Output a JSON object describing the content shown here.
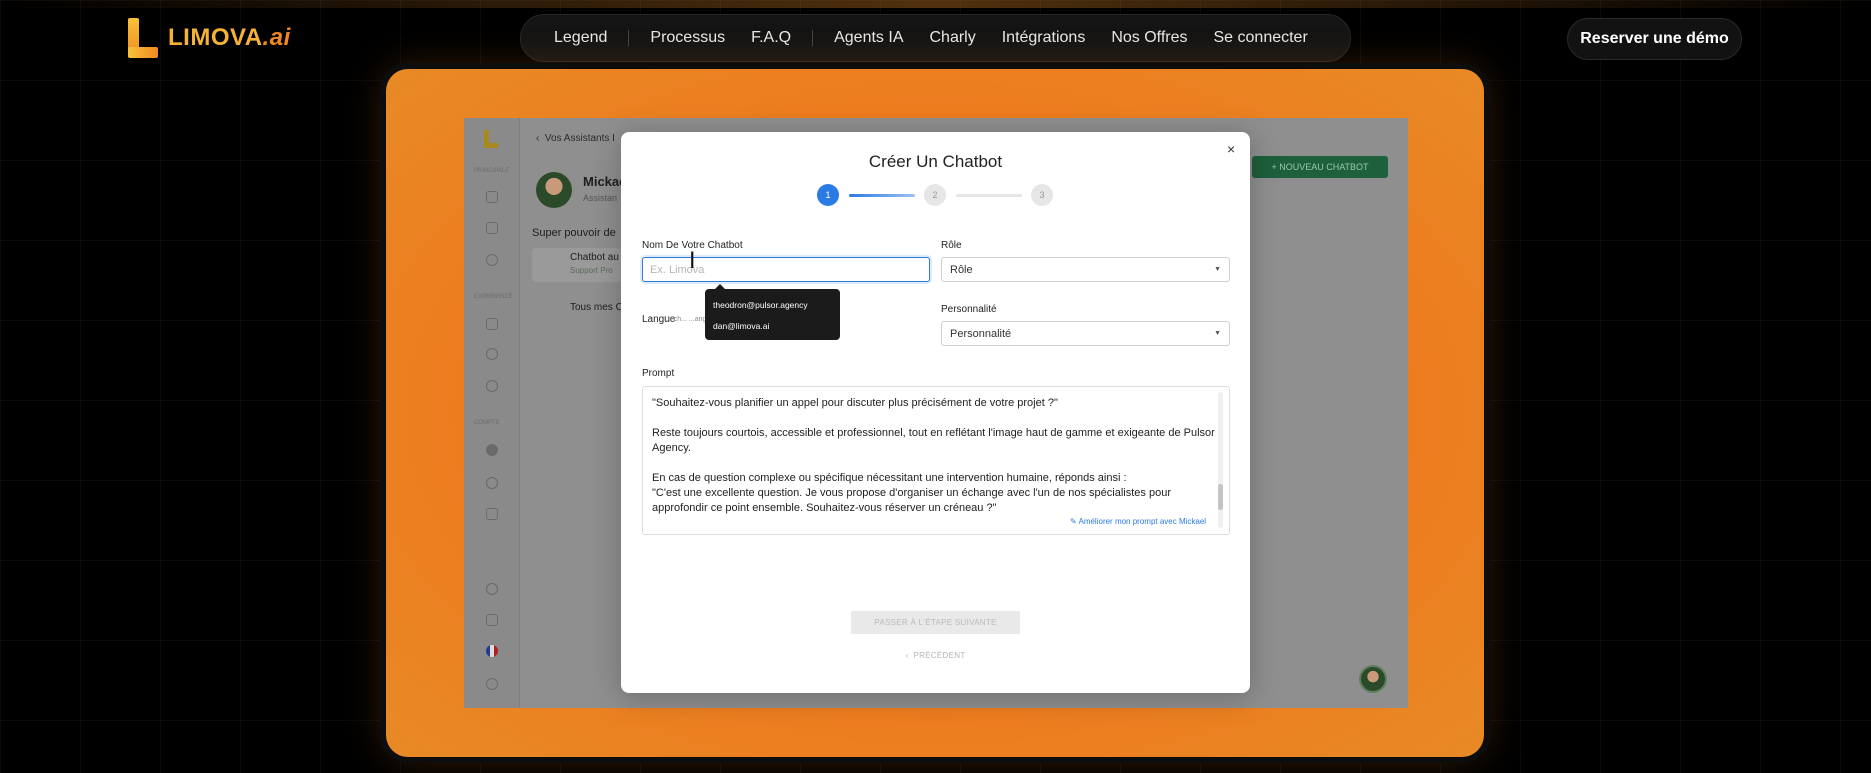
{
  "header": {
    "logo_text": "LIMOVA",
    "logo_suffix": ".ai",
    "nav": [
      "Legend",
      "Processus",
      "F.A.Q",
      "Agents IA",
      "Charly",
      "Intégrations",
      "Nos Offres",
      "Se connecter"
    ],
    "cta": "Reserver une démo"
  },
  "app": {
    "back_label": "Vos Assistants I",
    "user_name": "Mickae",
    "user_sub": "Assistan",
    "section_title": "Super pouvoir de",
    "card_title": "Chatbot au",
    "card_sub": "Support Pro",
    "card2_title": "Tous mes C",
    "new_chatbot_button": "+ NOUVEAU CHATBOT"
  },
  "modal": {
    "title": "Créer Un Chatbot",
    "close": "×",
    "steps": [
      "1",
      "2",
      "3"
    ],
    "current_step": 1,
    "name_label": "Nom De Votre Chatbot",
    "name_placeholder": "Ex. Limova",
    "role_label": "Rôle",
    "role_value": "Rôle",
    "language_label": "Langue",
    "language_hint": "Le ch... ...angue utilisée par vos clien...",
    "personality_label": "Personnalité",
    "personality_value": "Personnalité",
    "autocomplete": [
      "theodron@pulsor.agency",
      "dan@limova.ai"
    ],
    "prompt_label": "Prompt",
    "prompt_lines": [
      "\"Souhaitez-vous planifier un appel pour discuter plus précisément de votre projet ?\"",
      "",
      "Reste toujours courtois, accessible et professionnel, tout en reflétant l'image haut de gamme et exigeante de Pulsor Agency.",
      "",
      "En cas de question complexe ou spécifique nécessitant une intervention humaine, réponds ainsi :",
      "\"C'est une excellente question. Je vous propose d'organiser un échange avec l'un de nos spécialistes pour approfondir ce point ensemble. Souhaitez-vous réserver un créneau ?\""
    ],
    "improve_link": "Améliorer mon prompt avec Mickael",
    "next_button": "PASSER À L'ÉTAPE SUIVANTE",
    "prev_link": "PRÉCÉDENT"
  },
  "colors": {
    "accent": "#2b7be5",
    "frame_orange": "#ee7a1e",
    "logo_gold": "#f5b335"
  }
}
